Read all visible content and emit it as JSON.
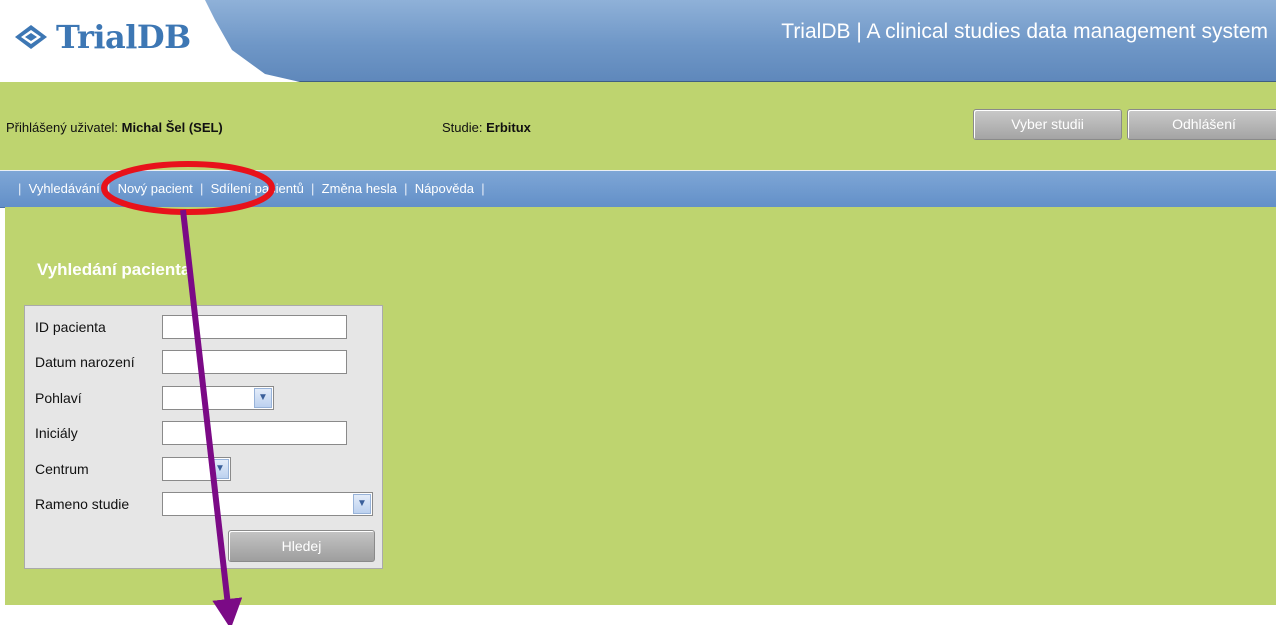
{
  "header": {
    "logo_text": "TrialDB",
    "app_title": "TrialDB | A clinical studies data management system"
  },
  "userbar": {
    "user_label": "Přihlášený uživatel: ",
    "user_value": "Michal Šel (SEL)",
    "study_label": "Studie: ",
    "study_value": "Erbitux",
    "select_study_button": "Vyber studii",
    "logout_button": "Odhlášení"
  },
  "nav": {
    "items": [
      "Vyhledávání",
      "Nový pacient",
      "Sdílení pacientů",
      "Změna hesla",
      "Nápověda"
    ],
    "separator": "|"
  },
  "search": {
    "title": "Vyhledání pacienta",
    "fields": [
      {
        "label": "ID pacienta",
        "type": "text",
        "value": ""
      },
      {
        "label": "Datum narození",
        "type": "text",
        "value": ""
      },
      {
        "label": "Pohlaví",
        "type": "select",
        "value": ""
      },
      {
        "label": "Iniciály",
        "type": "text",
        "value": ""
      },
      {
        "label": "Centrum",
        "type": "select",
        "value": ""
      },
      {
        "label": "Rameno studie",
        "type": "select",
        "value": ""
      }
    ],
    "submit_button": "Hledej"
  },
  "colors": {
    "header_blue": "#6f97c7",
    "nav_blue": "#6a97cf",
    "green_bg": "#bed46f",
    "logo_blue": "#3d77b4",
    "annotation_red": "#e8121b",
    "annotation_purple": "#7b0a86"
  },
  "icons": {
    "logo": "diamond-logo-icon",
    "dropdown": "chevron-down-icon",
    "annotation_circle": "red-ellipse-annotation",
    "annotation_arrow": "purple-arrow-annotation"
  }
}
